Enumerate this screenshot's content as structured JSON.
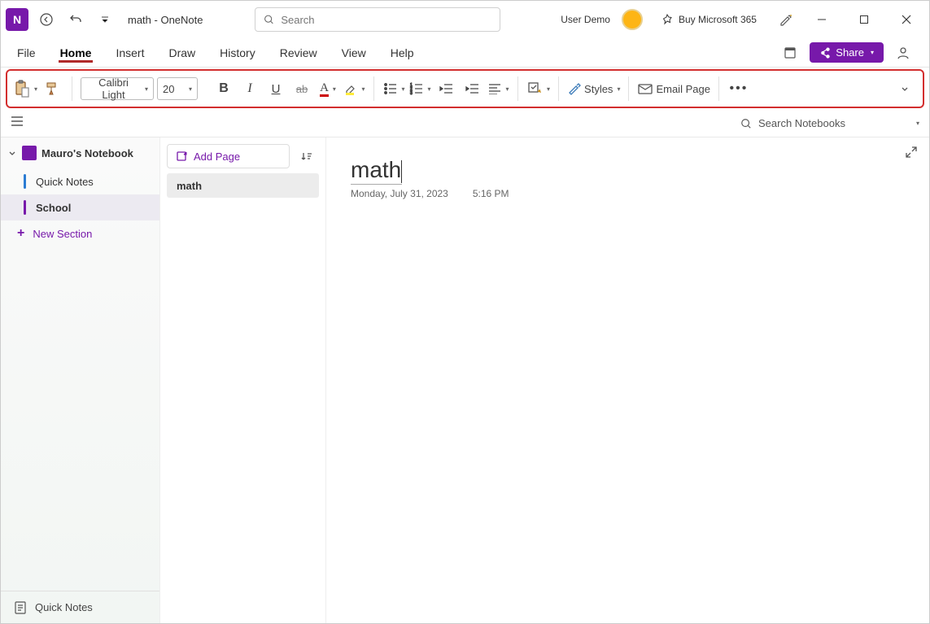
{
  "titlebar": {
    "doc_title": "math  -  OneNote",
    "search_placeholder": "Search",
    "user_label": "User Demo",
    "buy_label": "Buy Microsoft 365"
  },
  "menubar": {
    "items": [
      "File",
      "Home",
      "Insert",
      "Draw",
      "History",
      "Review",
      "View",
      "Help"
    ],
    "active_index": 1,
    "share_label": "Share"
  },
  "ribbon": {
    "font_name": "Calibri Light",
    "font_size": "20",
    "styles_label": "Styles",
    "email_label": "Email Page"
  },
  "subbar": {
    "search_label": "Search Notebooks"
  },
  "sidebar": {
    "notebook": "Mauro's Notebook",
    "sections": [
      {
        "label": "Quick Notes",
        "color": "#2b7cd3",
        "selected": false
      },
      {
        "label": "School",
        "color": "#7719AA",
        "selected": true
      }
    ],
    "new_section_label": "New Section",
    "footer_label": "Quick Notes"
  },
  "pagelist": {
    "add_label": "Add Page",
    "pages": [
      {
        "label": "math",
        "selected": true
      }
    ]
  },
  "canvas": {
    "title": "math",
    "date": "Monday, July 31, 2023",
    "time": "5:16 PM"
  }
}
